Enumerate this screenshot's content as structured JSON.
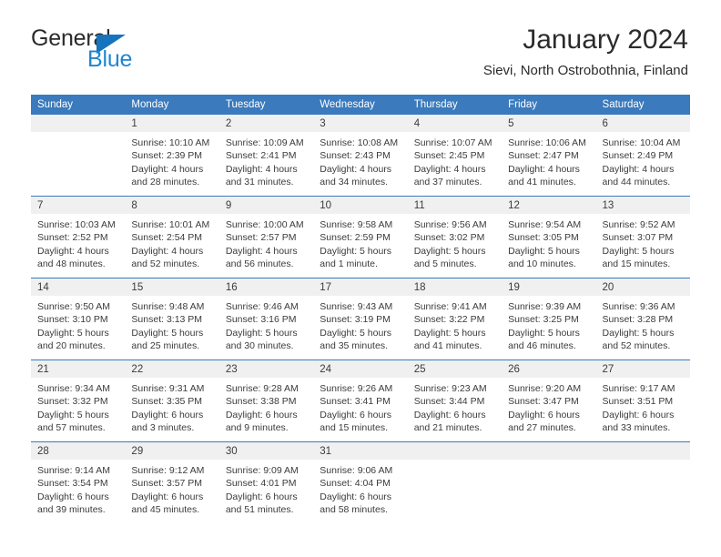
{
  "logo": {
    "word_one": "General",
    "word_two": "Blue",
    "triangle_color": "#1673bd",
    "blue_color": "#1f86d0"
  },
  "header": {
    "title": "January 2024",
    "subtitle": "Sievi, North Ostrobothnia, Finland"
  },
  "theme": {
    "header_blue": "#3a7abd",
    "daynum_band": "#f0f0f0",
    "text": "#3b3b3b"
  },
  "calendar": {
    "weekday_headers": [
      "Sunday",
      "Monday",
      "Tuesday",
      "Wednesday",
      "Thursday",
      "Friday",
      "Saturday"
    ],
    "weeks": [
      [
        {
          "day": "",
          "sunrise": "",
          "sunset": "",
          "daylight1": "",
          "daylight2": ""
        },
        {
          "day": "1",
          "sunrise": "Sunrise: 10:10 AM",
          "sunset": "Sunset: 2:39 PM",
          "daylight1": "Daylight: 4 hours",
          "daylight2": "and 28 minutes."
        },
        {
          "day": "2",
          "sunrise": "Sunrise: 10:09 AM",
          "sunset": "Sunset: 2:41 PM",
          "daylight1": "Daylight: 4 hours",
          "daylight2": "and 31 minutes."
        },
        {
          "day": "3",
          "sunrise": "Sunrise: 10:08 AM",
          "sunset": "Sunset: 2:43 PM",
          "daylight1": "Daylight: 4 hours",
          "daylight2": "and 34 minutes."
        },
        {
          "day": "4",
          "sunrise": "Sunrise: 10:07 AM",
          "sunset": "Sunset: 2:45 PM",
          "daylight1": "Daylight: 4 hours",
          "daylight2": "and 37 minutes."
        },
        {
          "day": "5",
          "sunrise": "Sunrise: 10:06 AM",
          "sunset": "Sunset: 2:47 PM",
          "daylight1": "Daylight: 4 hours",
          "daylight2": "and 41 minutes."
        },
        {
          "day": "6",
          "sunrise": "Sunrise: 10:04 AM",
          "sunset": "Sunset: 2:49 PM",
          "daylight1": "Daylight: 4 hours",
          "daylight2": "and 44 minutes."
        }
      ],
      [
        {
          "day": "7",
          "sunrise": "Sunrise: 10:03 AM",
          "sunset": "Sunset: 2:52 PM",
          "daylight1": "Daylight: 4 hours",
          "daylight2": "and 48 minutes."
        },
        {
          "day": "8",
          "sunrise": "Sunrise: 10:01 AM",
          "sunset": "Sunset: 2:54 PM",
          "daylight1": "Daylight: 4 hours",
          "daylight2": "and 52 minutes."
        },
        {
          "day": "9",
          "sunrise": "Sunrise: 10:00 AM",
          "sunset": "Sunset: 2:57 PM",
          "daylight1": "Daylight: 4 hours",
          "daylight2": "and 56 minutes."
        },
        {
          "day": "10",
          "sunrise": "Sunrise: 9:58 AM",
          "sunset": "Sunset: 2:59 PM",
          "daylight1": "Daylight: 5 hours",
          "daylight2": "and 1 minute."
        },
        {
          "day": "11",
          "sunrise": "Sunrise: 9:56 AM",
          "sunset": "Sunset: 3:02 PM",
          "daylight1": "Daylight: 5 hours",
          "daylight2": "and 5 minutes."
        },
        {
          "day": "12",
          "sunrise": "Sunrise: 9:54 AM",
          "sunset": "Sunset: 3:05 PM",
          "daylight1": "Daylight: 5 hours",
          "daylight2": "and 10 minutes."
        },
        {
          "day": "13",
          "sunrise": "Sunrise: 9:52 AM",
          "sunset": "Sunset: 3:07 PM",
          "daylight1": "Daylight: 5 hours",
          "daylight2": "and 15 minutes."
        }
      ],
      [
        {
          "day": "14",
          "sunrise": "Sunrise: 9:50 AM",
          "sunset": "Sunset: 3:10 PM",
          "daylight1": "Daylight: 5 hours",
          "daylight2": "and 20 minutes."
        },
        {
          "day": "15",
          "sunrise": "Sunrise: 9:48 AM",
          "sunset": "Sunset: 3:13 PM",
          "daylight1": "Daylight: 5 hours",
          "daylight2": "and 25 minutes."
        },
        {
          "day": "16",
          "sunrise": "Sunrise: 9:46 AM",
          "sunset": "Sunset: 3:16 PM",
          "daylight1": "Daylight: 5 hours",
          "daylight2": "and 30 minutes."
        },
        {
          "day": "17",
          "sunrise": "Sunrise: 9:43 AM",
          "sunset": "Sunset: 3:19 PM",
          "daylight1": "Daylight: 5 hours",
          "daylight2": "and 35 minutes."
        },
        {
          "day": "18",
          "sunrise": "Sunrise: 9:41 AM",
          "sunset": "Sunset: 3:22 PM",
          "daylight1": "Daylight: 5 hours",
          "daylight2": "and 41 minutes."
        },
        {
          "day": "19",
          "sunrise": "Sunrise: 9:39 AM",
          "sunset": "Sunset: 3:25 PM",
          "daylight1": "Daylight: 5 hours",
          "daylight2": "and 46 minutes."
        },
        {
          "day": "20",
          "sunrise": "Sunrise: 9:36 AM",
          "sunset": "Sunset: 3:28 PM",
          "daylight1": "Daylight: 5 hours",
          "daylight2": "and 52 minutes."
        }
      ],
      [
        {
          "day": "21",
          "sunrise": "Sunrise: 9:34 AM",
          "sunset": "Sunset: 3:32 PM",
          "daylight1": "Daylight: 5 hours",
          "daylight2": "and 57 minutes."
        },
        {
          "day": "22",
          "sunrise": "Sunrise: 9:31 AM",
          "sunset": "Sunset: 3:35 PM",
          "daylight1": "Daylight: 6 hours",
          "daylight2": "and 3 minutes."
        },
        {
          "day": "23",
          "sunrise": "Sunrise: 9:28 AM",
          "sunset": "Sunset: 3:38 PM",
          "daylight1": "Daylight: 6 hours",
          "daylight2": "and 9 minutes."
        },
        {
          "day": "24",
          "sunrise": "Sunrise: 9:26 AM",
          "sunset": "Sunset: 3:41 PM",
          "daylight1": "Daylight: 6 hours",
          "daylight2": "and 15 minutes."
        },
        {
          "day": "25",
          "sunrise": "Sunrise: 9:23 AM",
          "sunset": "Sunset: 3:44 PM",
          "daylight1": "Daylight: 6 hours",
          "daylight2": "and 21 minutes."
        },
        {
          "day": "26",
          "sunrise": "Sunrise: 9:20 AM",
          "sunset": "Sunset: 3:47 PM",
          "daylight1": "Daylight: 6 hours",
          "daylight2": "and 27 minutes."
        },
        {
          "day": "27",
          "sunrise": "Sunrise: 9:17 AM",
          "sunset": "Sunset: 3:51 PM",
          "daylight1": "Daylight: 6 hours",
          "daylight2": "and 33 minutes."
        }
      ],
      [
        {
          "day": "28",
          "sunrise": "Sunrise: 9:14 AM",
          "sunset": "Sunset: 3:54 PM",
          "daylight1": "Daylight: 6 hours",
          "daylight2": "and 39 minutes."
        },
        {
          "day": "29",
          "sunrise": "Sunrise: 9:12 AM",
          "sunset": "Sunset: 3:57 PM",
          "daylight1": "Daylight: 6 hours",
          "daylight2": "and 45 minutes."
        },
        {
          "day": "30",
          "sunrise": "Sunrise: 9:09 AM",
          "sunset": "Sunset: 4:01 PM",
          "daylight1": "Daylight: 6 hours",
          "daylight2": "and 51 minutes."
        },
        {
          "day": "31",
          "sunrise": "Sunrise: 9:06 AM",
          "sunset": "Sunset: 4:04 PM",
          "daylight1": "Daylight: 6 hours",
          "daylight2": "and 58 minutes."
        },
        {
          "day": "",
          "sunrise": "",
          "sunset": "",
          "daylight1": "",
          "daylight2": ""
        },
        {
          "day": "",
          "sunrise": "",
          "sunset": "",
          "daylight1": "",
          "daylight2": ""
        },
        {
          "day": "",
          "sunrise": "",
          "sunset": "",
          "daylight1": "",
          "daylight2": ""
        }
      ]
    ]
  }
}
